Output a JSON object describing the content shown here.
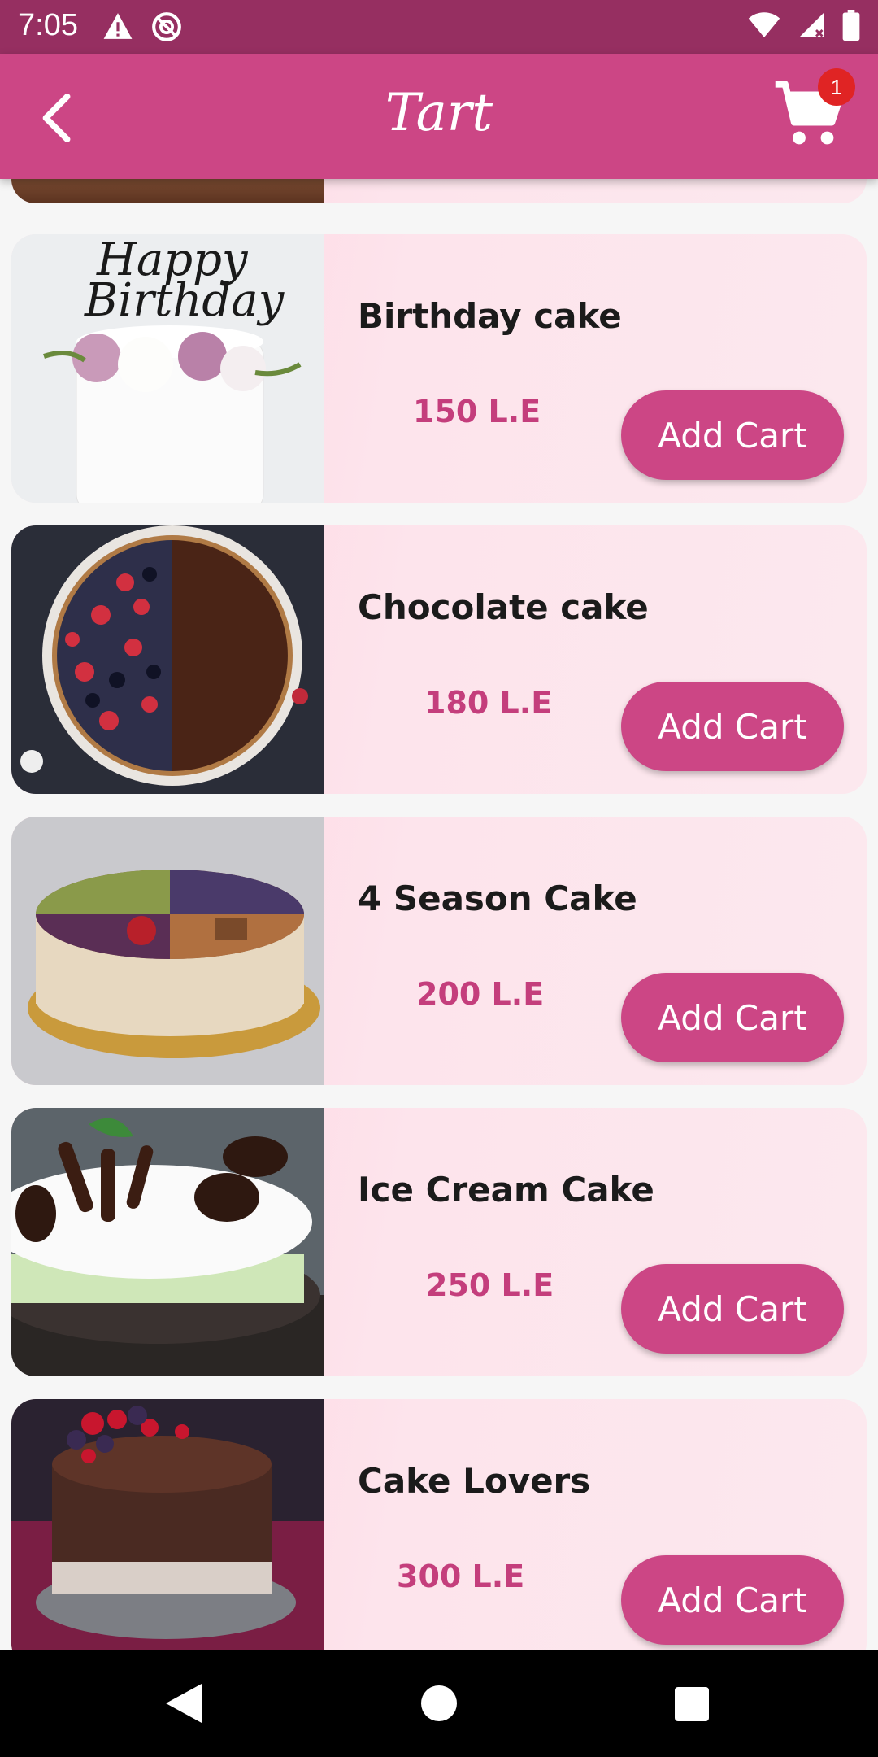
{
  "status_bar": {
    "time": "7:05",
    "left_icons": [
      "warning-icon",
      "do-not-disturb-icon"
    ],
    "right_icons": [
      "wifi-icon",
      "signal-icon",
      "battery-icon"
    ]
  },
  "app_bar": {
    "title": "Tart",
    "back_icon": "chevron-left-icon",
    "cart_icon": "shopping-cart-icon",
    "cart_badge_count": "1"
  },
  "products": [
    {
      "name": "Birthday cake",
      "price": "150 L.E",
      "button_label": "Add Cart",
      "image": "birthday-cake-image"
    },
    {
      "name": "Chocolate cake",
      "price": "180 L.E",
      "button_label": "Add Cart",
      "image": "chocolate-berry-tart-image"
    },
    {
      "name": "4 Season Cake",
      "price": "200 L.E",
      "button_label": "Add Cart",
      "image": "four-season-cake-image"
    },
    {
      "name": "Ice Cream Cake",
      "price": "250 L.E",
      "button_label": "Add Cart",
      "image": "ice-cream-cake-image"
    },
    {
      "name": "Cake Lovers",
      "price": "300 L.E",
      "button_label": "Add Cart",
      "image": "cake-lovers-image"
    }
  ],
  "nav_bar": {
    "icons": [
      "nav-back-icon",
      "nav-home-icon",
      "nav-recents-icon"
    ]
  },
  "colors": {
    "status_bar": "#962f61",
    "app_bar": "#cc4685",
    "button": "#cc4685",
    "price": "#c43e7c",
    "card_bg": "#fde4ec",
    "badge": "#e02424"
  }
}
